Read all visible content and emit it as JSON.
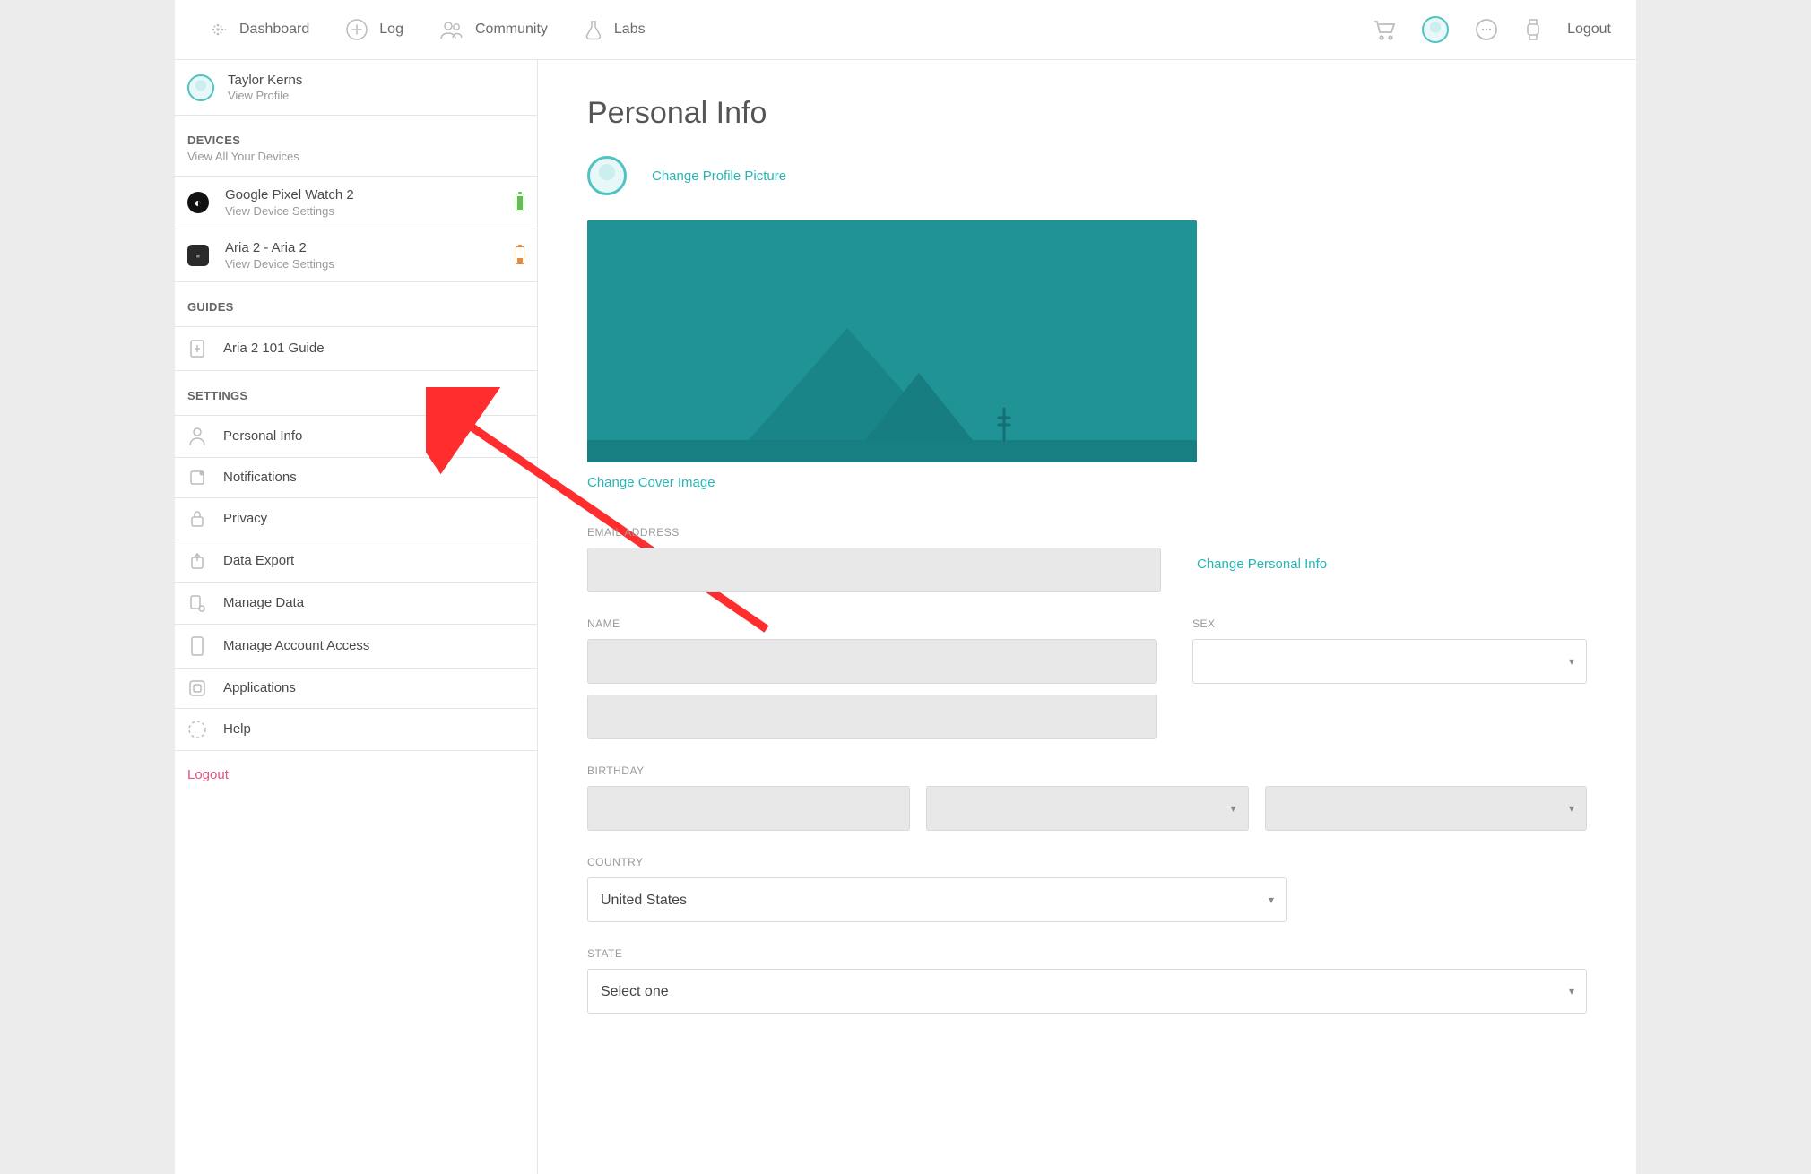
{
  "topnav": {
    "items": [
      {
        "label": "Dashboard"
      },
      {
        "label": "Log"
      },
      {
        "label": "Community"
      },
      {
        "label": "Labs"
      }
    ],
    "logout": "Logout"
  },
  "sidebar": {
    "profile": {
      "name": "Taylor Kerns",
      "sub": "View Profile"
    },
    "devices_head": {
      "title": "DEVICES",
      "sub": "View All Your Devices"
    },
    "devices": [
      {
        "name": "Google Pixel Watch 2",
        "sub": "View Device Settings",
        "battery": "green"
      },
      {
        "name": "Aria 2 - Aria 2",
        "sub": "View Device Settings",
        "battery": "orange"
      }
    ],
    "guides_head": {
      "title": "GUIDES"
    },
    "guides": [
      {
        "label": "Aria 2 101 Guide"
      }
    ],
    "settings_head": {
      "title": "SETTINGS"
    },
    "settings": [
      {
        "label": "Personal Info"
      },
      {
        "label": "Notifications"
      },
      {
        "label": "Privacy"
      },
      {
        "label": "Data Export"
      },
      {
        "label": "Manage Data"
      },
      {
        "label": "Manage Account Access"
      },
      {
        "label": "Applications"
      },
      {
        "label": "Help"
      }
    ],
    "logout": "Logout"
  },
  "main": {
    "title": "Personal Info",
    "change_picture": "Change Profile Picture",
    "change_cover": "Change Cover Image",
    "change_personal": "Change Personal Info",
    "labels": {
      "email": "EMAIL ADDRESS",
      "name": "NAME",
      "sex": "SEX",
      "birthday": "BIRTHDAY",
      "country": "COUNTRY",
      "state": "STATE"
    },
    "values": {
      "email": "",
      "first_name": "",
      "last_name": "",
      "sex": "",
      "birth_year": "",
      "birth_month": "",
      "birth_day": "",
      "country": "United States",
      "state": "Select one"
    }
  }
}
